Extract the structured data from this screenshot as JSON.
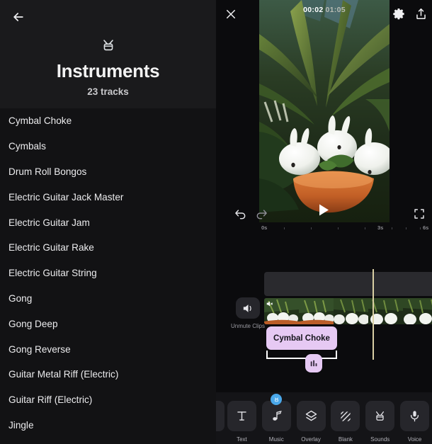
{
  "left_panel": {
    "back_icon": "arrow-left-icon",
    "header_icon": "drum-icon",
    "title": "Instruments",
    "subtitle": "23 tracks",
    "tracks": [
      "Cymbal Choke",
      "Cymbals",
      "Drum Roll Bongos",
      "Electric Guitar Jack Master",
      "Electric Guitar Jam",
      "Electric Guitar Rake",
      "Electric Guitar String",
      "Gong",
      "Gong Deep",
      "Gong Reverse",
      "Guitar Metal Riff (Electric)",
      "Guitar Riff (Electric)",
      "Jingle"
    ]
  },
  "editor": {
    "close_icon": "close-icon",
    "settings_icon": "gear-icon",
    "share_icon": "share-upload-icon",
    "preview": {
      "current_time": "00:02",
      "total_time": "01:05",
      "play_icon": "play-icon",
      "scene_description": "white rabbits eating greens from an orange bowl among plants"
    },
    "transport": {
      "undo_icon": "undo-icon",
      "redo_icon": "redo-icon",
      "fullscreen_icon": "fullscreen-icon"
    },
    "ruler": {
      "labels": [
        "0s",
        "3s",
        "6s"
      ]
    },
    "timeline": {
      "unmute_icon": "speaker-volume-icon",
      "unmute_label": "Unmute Clips",
      "mute_badge_icon": "speaker-mute-icon",
      "audio_clip_label": "Cymbal Choke",
      "audio_clip_color": "#e6c9f3",
      "playhead_color": "#d9cfa4",
      "eq_chip_icon": "equalizer-icon"
    },
    "toolbar": [
      {
        "label": "Text",
        "icon": "text-icon",
        "badge": false
      },
      {
        "label": "Music",
        "icon": "music-note-icon",
        "badge": true,
        "badge_icon": "drum-icon"
      },
      {
        "label": "Overlay",
        "icon": "layers-icon",
        "badge": false
      },
      {
        "label": "Blank",
        "icon": "hatch-square-icon",
        "badge": false
      },
      {
        "label": "Sounds",
        "icon": "drum-icon",
        "badge": false
      },
      {
        "label": "Voice",
        "icon": "microphone-icon",
        "badge": false
      }
    ]
  },
  "colors": {
    "panel_bg": "#121214",
    "header_bg": "#1a1a1c",
    "editor_bg": "#0b0b0d",
    "accent_purple": "#e6c9f3",
    "accent_blue": "#4aa8ea",
    "playhead": "#d9cfa4"
  }
}
